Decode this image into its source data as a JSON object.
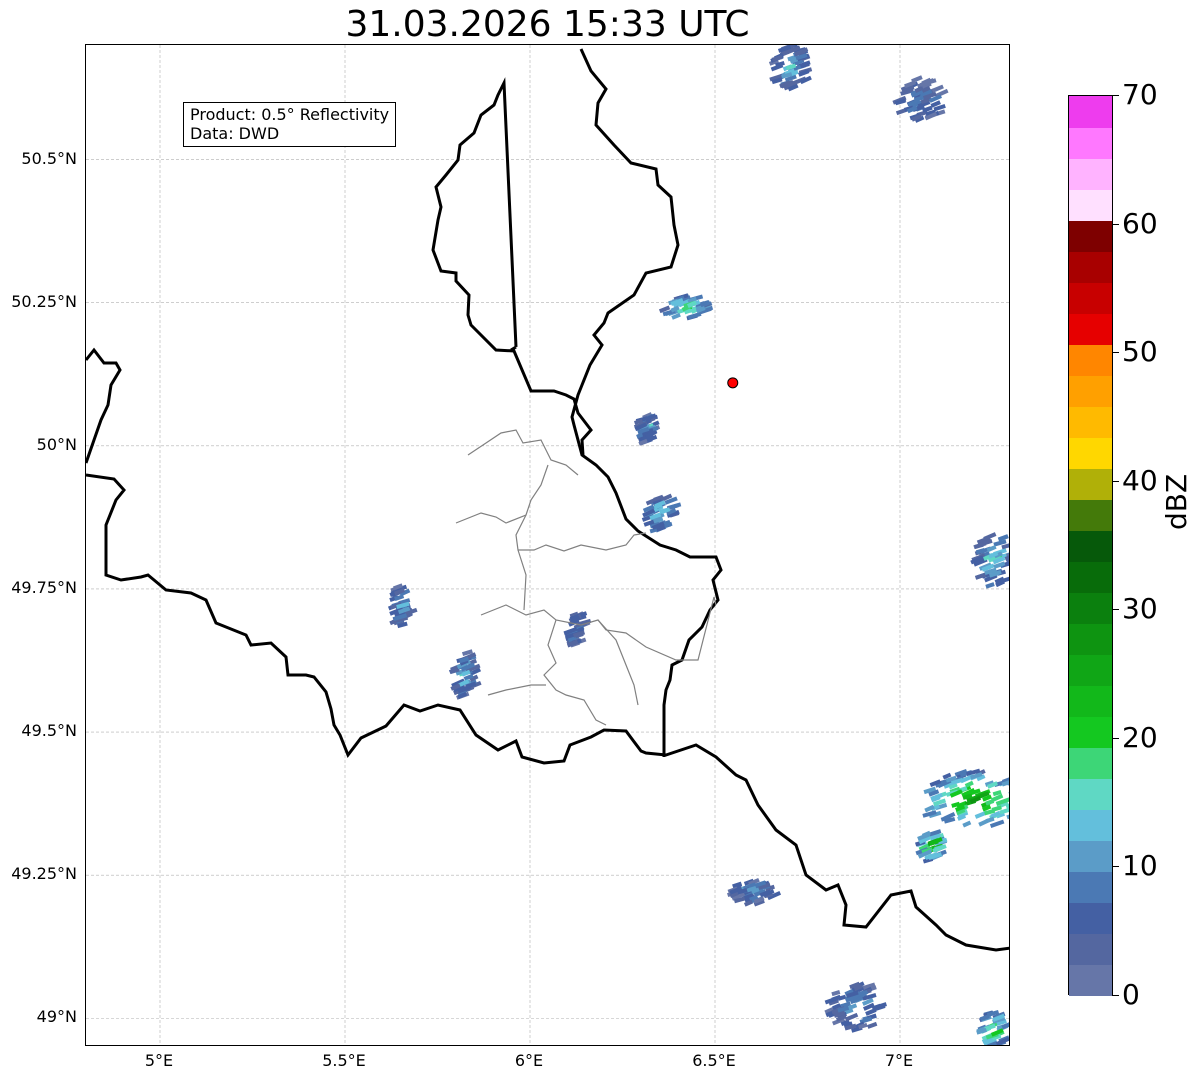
{
  "title": "31.03.2026 15:33 UTC",
  "info_box": {
    "line1": "Product: 0.5° Reflectivity",
    "line2": "Data: DWD"
  },
  "map": {
    "lon_range": [
      4.8,
      7.3
    ],
    "lat_range": [
      48.95,
      50.7
    ],
    "lat_ticks": [
      {
        "value": 50.5,
        "label": "50.5°N"
      },
      {
        "value": 50.25,
        "label": "50.25°N"
      },
      {
        "value": 50.0,
        "label": "50°N"
      },
      {
        "value": 49.75,
        "label": "49.75°N"
      },
      {
        "value": 49.5,
        "label": "49.5°N"
      },
      {
        "value": 49.25,
        "label": "49.25°N"
      },
      {
        "value": 49.0,
        "label": "49°N"
      }
    ],
    "lon_ticks": [
      {
        "value": 5.0,
        "label": "5°E"
      },
      {
        "value": 5.5,
        "label": "5.5°E"
      },
      {
        "value": 6.0,
        "label": "6°E"
      },
      {
        "value": 6.5,
        "label": "6.5°E"
      },
      {
        "value": 7.0,
        "label": "7°E"
      }
    ],
    "grid": true,
    "site_marker": {
      "lon": 6.548,
      "lat": 50.11,
      "color": "#ff0000"
    }
  },
  "colorbar": {
    "unit": "dBZ",
    "range": [
      0,
      70
    ],
    "step": 2.5,
    "tick_labels": [
      "0",
      "10",
      "20",
      "30",
      "40",
      "50",
      "60",
      "70"
    ],
    "colors": [
      "#6676a8",
      "#5467a0",
      "#4460a3",
      "#4b79b4",
      "#5b9cc8",
      "#63bfdc",
      "#5fd8c4",
      "#3dd677",
      "#14c820",
      "#12b81a",
      "#10a616",
      "#0e9411",
      "#0b800e",
      "#086c0a",
      "#06590a",
      "#447a0a",
      "#b0b008",
      "#ffd700",
      "#ffba00",
      "#ffa000",
      "#ff8600",
      "#e60000",
      "#c80000",
      "#a80000",
      "#7e0000",
      "#ffe0ff",
      "#ffb3ff",
      "#ff78ff",
      "#ee3cee"
    ]
  },
  "reflectivity_cells": [
    {
      "lon": 6.35,
      "lat": 49.88,
      "dbz": 20,
      "w": 0.08,
      "h": 0.06
    },
    {
      "lon": 6.42,
      "lat": 50.24,
      "dbz": 22,
      "w": 0.12,
      "h": 0.04
    },
    {
      "lon": 6.31,
      "lat": 50.03,
      "dbz": 14,
      "w": 0.04,
      "h": 0.05
    },
    {
      "lon": 7.2,
      "lat": 49.38,
      "dbz": 28,
      "w": 0.3,
      "h": 0.1
    },
    {
      "lon": 7.08,
      "lat": 49.3,
      "dbz": 33,
      "w": 0.06,
      "h": 0.05
    },
    {
      "lon": 7.25,
      "lat": 49.8,
      "dbz": 18,
      "w": 0.1,
      "h": 0.1
    },
    {
      "lon": 7.25,
      "lat": 48.98,
      "dbz": 24,
      "w": 0.08,
      "h": 0.06
    },
    {
      "lon": 6.88,
      "lat": 49.02,
      "dbz": 12,
      "w": 0.15,
      "h": 0.08
    },
    {
      "lon": 7.05,
      "lat": 50.6,
      "dbz": 10,
      "w": 0.12,
      "h": 0.08
    },
    {
      "lon": 6.7,
      "lat": 50.66,
      "dbz": 14,
      "w": 0.1,
      "h": 0.08
    },
    {
      "lon": 5.65,
      "lat": 49.72,
      "dbz": 12,
      "w": 0.05,
      "h": 0.08
    },
    {
      "lon": 5.82,
      "lat": 49.6,
      "dbz": 14,
      "w": 0.06,
      "h": 0.08
    },
    {
      "lon": 6.12,
      "lat": 49.68,
      "dbz": 11,
      "w": 0.04,
      "h": 0.06
    },
    {
      "lon": 6.6,
      "lat": 49.22,
      "dbz": 12,
      "w": 0.12,
      "h": 0.04
    }
  ]
}
